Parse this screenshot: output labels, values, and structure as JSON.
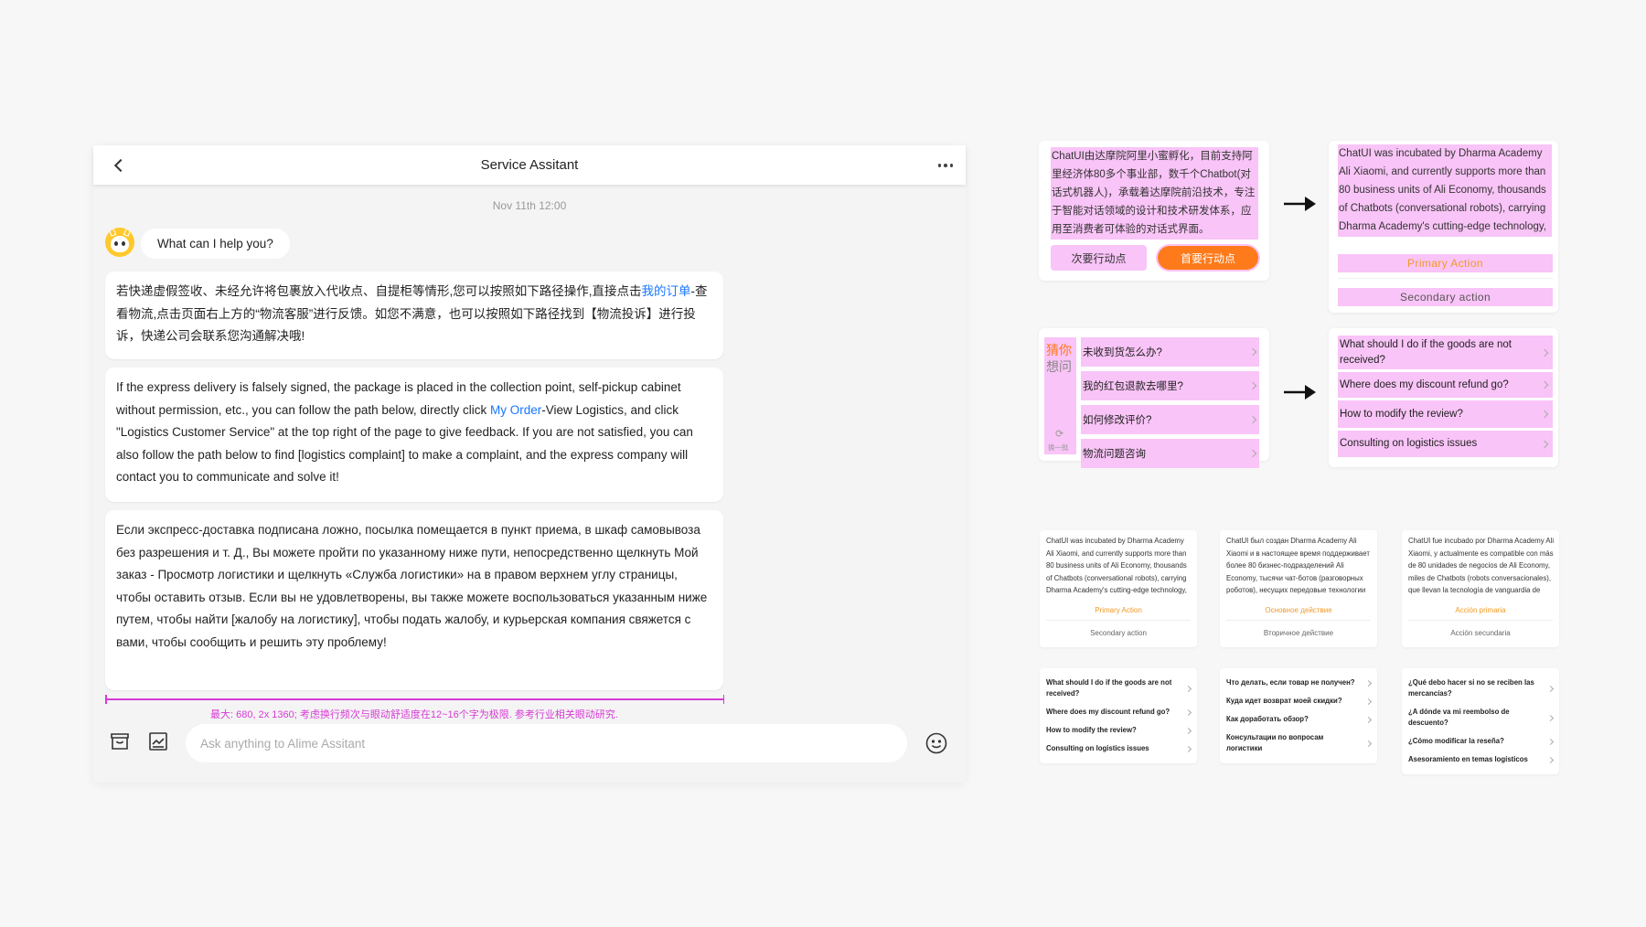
{
  "chat": {
    "title": "Service Assitant",
    "timestamp": "Nov 11th 12:00",
    "greeting": "What can I help you?",
    "messages": {
      "zh": {
        "before": "若快递虚假签收、未经允许将包裹放入代收点、自提柜等情形,您可以按照如下路径操作,直接点击",
        "link": "我的订单",
        "after": "-查看物流,点击页面右上方的“物流客服”进行反馈。如您不满意，也可以按照如下路径找到【物流投诉】进行投诉，快递公司会联系您沟通解决哦!"
      },
      "en": {
        "before": "If the express delivery is falsely signed, the package is placed in the collection point, self-pickup cabinet without permission, etc., you can follow the path below, directly click ",
        "link": "My Order",
        "after": "-View Logistics, and click \"Logistics Customer Service\" at the top right of the page to give feedback. If you are not satisfied, you can also follow the path below to find [logistics complaint] to make a complaint, and the express company will contact you to communicate and solve it!"
      },
      "ru": "Если экспресс-доставка подписана ложно, посылка помещается в пункт приема, в шкаф самовывоза без разрешения и т. Д., Вы можете пройти по указанному ниже пути, непосредственно щелкнуть Мой заказ - Просмотр логистики и щелкнуть «Служба логистики» на в правом верхнем углу страницы, чтобы оставить отзыв. Если вы не удовлетворены, вы также можете воспользоваться указанным ниже путем, чтобы найти [жалобу на логистику], чтобы подать жалобу, и курьерская компания свяжется с вами, чтобы сообщить и решить эту проблему!"
    },
    "measure_note": "最大: 680, 2x 1360; 考虑换行频次与眼动舒适度在12~16个字为极限. 参考行业相关眼动研究.",
    "input_placeholder": "Ask anything to Alime Assitant",
    "icons": {
      "back": "chevron-left-icon",
      "more": "more-dots-icon",
      "shop": "shop-icon",
      "chart": "chart-icon",
      "emoji": "emoji-icon"
    }
  },
  "compare": {
    "card_zh": {
      "text": "ChatUI由达摩院阿里小蜜孵化，目前支持阿里经济体80多个事业部，数千个Chatbot(对话式机器人)，承载着达摩院前沿技术，专注于智能对话领域的设计和技术研发体系，应用至消费者可体验的对话式界面。",
      "secondary": "次要行动点",
      "primary": "首要行动点"
    },
    "card_en": {
      "text": "ChatUI was incubated by Dharma Academy Ali Xiaomi, and currently supports more than 80 business units of Ali Economy, thousands of Chatbots (conversational robots), carrying Dharma Academy's cutting-edge technology,",
      "primary": "Primary Action",
      "secondary": "Secondary action"
    },
    "faq_zh": {
      "side_top": "猜你",
      "side_bottom": "想问",
      "refresh": "换一批",
      "items": [
        "未收到货怎么办?",
        "我的红包退款去哪里?",
        "如何修改评价?",
        "物流问题咨询"
      ]
    },
    "faq_en": {
      "items": [
        "What should I do if the goods are not received?",
        "Where does my discount refund go?",
        "How to modify the review?",
        "Consulting on logistics issues"
      ]
    },
    "small_cards": [
      {
        "text": "ChatUI was incubated by Dharma Academy Ali Xiaomi, and currently supports more than 80 business units of Ali Economy, thousands of Chatbots (conversational robots), carrying Dharma Academy's cutting-edge technology,",
        "primary": "Primary Action",
        "secondary": "Secondary action",
        "faq": [
          "What should I do if the goods are not received?",
          "Where does my discount refund go?",
          "How to modify the review?",
          "Consulting on logistics issues"
        ]
      },
      {
        "text": "ChatUI был создан Dharma Academy Ali Xiaomi и в настоящее время поддерживает более 80 бизнес-подразделений Ali Economy, тысячи чат-ботов (разговорных роботов), несущих передовые технологии",
        "primary": "Основное действие",
        "secondary": "Вторичное действие",
        "faq": [
          "Что делать, если товар не получен?",
          "Куда идет возврат моей скидки?",
          "Как доработать обзор?",
          "Консультации по вопросам логистики"
        ]
      },
      {
        "text": "ChatUI fue incubado por Dharma Academy Ali Xiaomi, y actualmente es compatible con más de 80 unidades de negocios de Ali Economy, miles de Chatbots (robots conversacionales), que llevan la tecnología de vanguardia de",
        "primary": "Acción primaria",
        "secondary": "Acción secundaria",
        "faq": [
          "¿Qué debo hacer si no se reciben las mercancías?",
          "¿A dónde va mi reembolso de descuento?",
          "¿Cómo modificar la reseña?",
          "Asesoramiento en temas logísticos"
        ]
      }
    ],
    "colors": {
      "highlight": "#f9c4f7",
      "primary_orange": "#ff7a1a",
      "action_text": "#f29a26",
      "link_blue": "#1677ff",
      "measure_magenta": "#d63ad6"
    }
  }
}
